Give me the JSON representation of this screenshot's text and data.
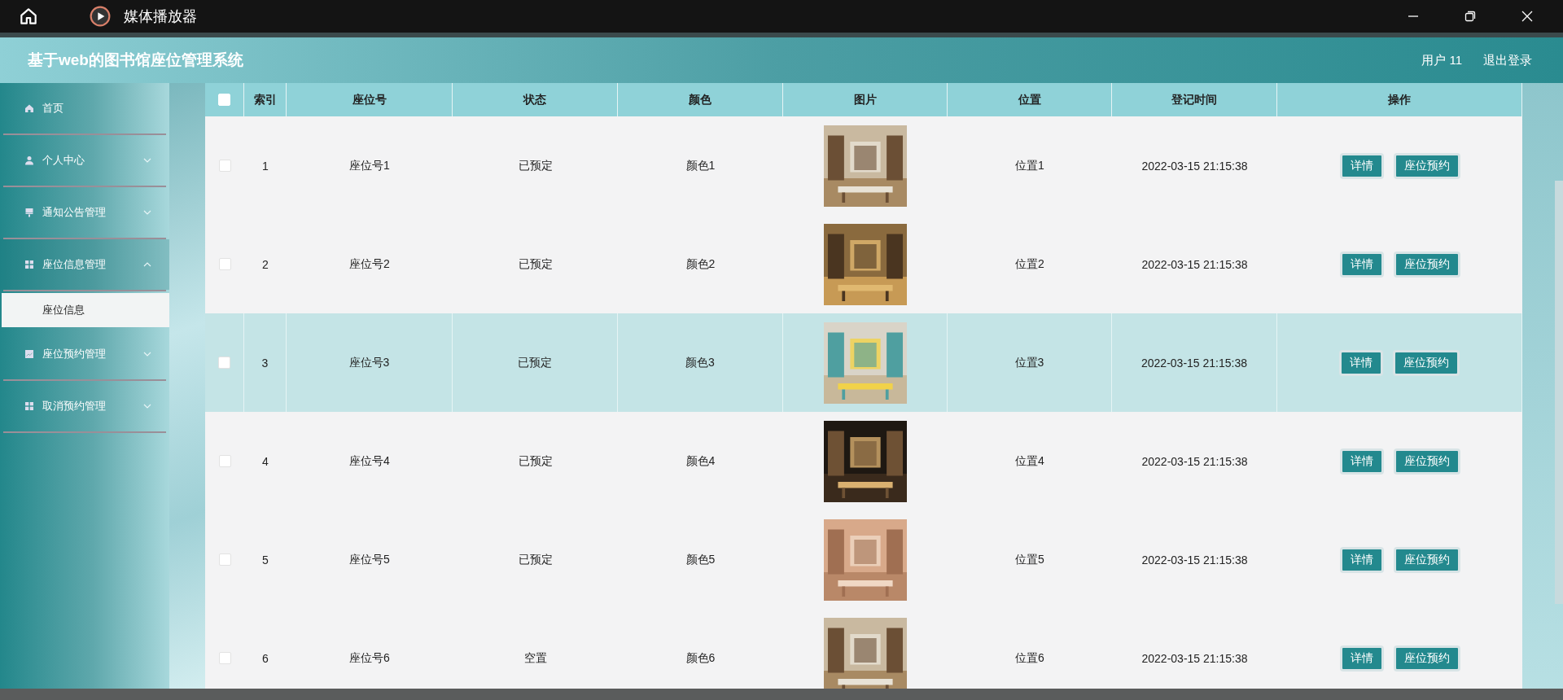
{
  "titlebar": {
    "title": "媒体播放器"
  },
  "header": {
    "title": "基于web的图书馆座位管理系统",
    "user": "用户 11",
    "logout": "退出登录"
  },
  "sidebar": {
    "items": [
      {
        "label": "首页",
        "expanded": false
      },
      {
        "label": "个人中心",
        "expanded": false
      },
      {
        "label": "通知公告管理",
        "expanded": false
      },
      {
        "label": "座位信息管理",
        "expanded": true,
        "children": [
          {
            "label": "座位信息",
            "selected": true
          }
        ]
      },
      {
        "label": "座位预约管理",
        "expanded": false
      },
      {
        "label": "取消预约管理",
        "expanded": false
      }
    ]
  },
  "table": {
    "all_checked": false,
    "columns": [
      "索引",
      "座位号",
      "状态",
      "颜色",
      "图片",
      "位置",
      "登记时间",
      "操作"
    ],
    "rows": [
      {
        "checked": false,
        "highlighted": false,
        "index": "1",
        "seat": "座位号1",
        "status": "已预定",
        "seat_colour": "颜色1",
        "location": "位置1",
        "time": "2022-03-15 21:15:38",
        "actions": [
          "详情",
          "座位预约"
        ]
      },
      {
        "checked": false,
        "highlighted": false,
        "index": "2",
        "seat": "座位号2",
        "status": "已预定",
        "seat_colour": "颜色2",
        "location": "位置2",
        "time": "2022-03-15 21:15:38",
        "actions": [
          "详情",
          "座位预约"
        ]
      },
      {
        "checked": false,
        "highlighted": true,
        "index": "3",
        "seat": "座位号3",
        "status": "已预定",
        "seat_colour": "颜色3",
        "location": "位置3",
        "time": "2022-03-15 21:15:38",
        "actions": [
          "详情",
          "座位预约"
        ]
      },
      {
        "checked": false,
        "highlighted": false,
        "index": "4",
        "seat": "座位号4",
        "status": "已预定",
        "seat_colour": "颜色4",
        "location": "位置4",
        "time": "2022-03-15 21:15:38",
        "actions": [
          "详情",
          "座位预约"
        ]
      },
      {
        "checked": false,
        "highlighted": false,
        "index": "5",
        "seat": "座位号5",
        "status": "已预定",
        "seat_colour": "颜色5",
        "location": "位置5",
        "time": "2022-03-15 21:15:38",
        "actions": [
          "详情",
          "座位预约"
        ]
      },
      {
        "checked": false,
        "highlighted": false,
        "index": "6",
        "seat": "座位号6",
        "status": "空置",
        "seat_colour": "颜色6",
        "location": "位置6",
        "time": "2022-03-15 21:15:38",
        "actions": [
          "详情",
          "座位预约"
        ]
      }
    ]
  }
}
